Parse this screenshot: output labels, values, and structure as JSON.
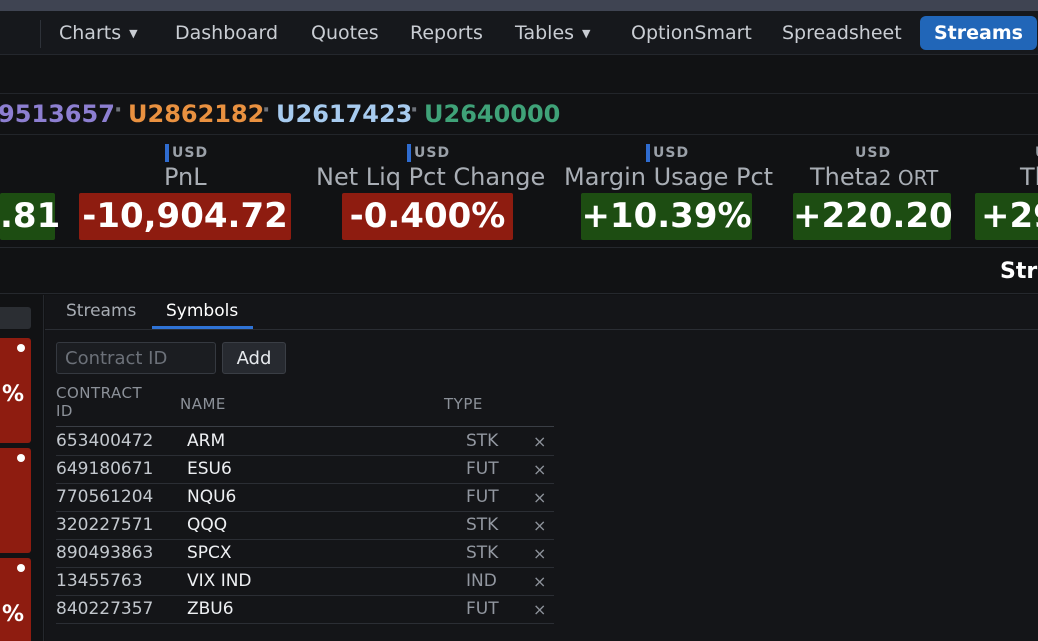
{
  "nav": {
    "items": [
      {
        "label": "Charts",
        "dropdown": true
      },
      {
        "label": "Dashboard",
        "dropdown": false
      },
      {
        "label": "Quotes",
        "dropdown": false
      },
      {
        "label": "Reports",
        "dropdown": false
      },
      {
        "label": "Tables",
        "dropdown": true
      },
      {
        "label": "OptionSmart",
        "dropdown": false
      },
      {
        "label": "Spreadsheet",
        "dropdown": false
      }
    ],
    "active": "Streams",
    "caret": "▼"
  },
  "accounts": {
    "separator": "·",
    "items": [
      {
        "id": "9513657",
        "color": "#8d7fd1"
      },
      {
        "id": "U2862182",
        "color": "#e99140"
      },
      {
        "id": "U2617423",
        "color": "#a7cbef"
      },
      {
        "id": "U2640000",
        "color": "#3fa278"
      }
    ]
  },
  "metrics": [
    {
      "currency": "",
      "label": "",
      "value": ".81",
      "sign": "positive"
    },
    {
      "currency": "USD",
      "label": "PnL",
      "value": "-10,904.72",
      "sign": "negative"
    },
    {
      "currency": "USD",
      "label": "Net Liq Pct Change",
      "value": "-0.400%",
      "sign": "negative"
    },
    {
      "currency": "USD",
      "label": "Margin Usage Pct",
      "value": "+10.39%",
      "sign": "positive"
    },
    {
      "currency": "USD",
      "label": "Theta",
      "label_sub": "2 ORT",
      "value": "+220.20",
      "sign": "positive"
    },
    {
      "currency": "U",
      "label": "Th",
      "value": "+29",
      "sign": "positive"
    }
  ],
  "section_title": "Str",
  "left_cards": [
    {
      "text": "%"
    },
    {
      "text": ""
    },
    {
      "text": "%"
    }
  ],
  "tabs": [
    {
      "label": "Streams",
      "active": false
    },
    {
      "label": "Symbols",
      "active": true
    }
  ],
  "form": {
    "placeholder": "Contract ID",
    "value": "",
    "add_label": "Add"
  },
  "table": {
    "headers": {
      "contract_id_1": "CONTRACT",
      "contract_id_2": "ID",
      "name": "NAME",
      "type": "TYPE"
    },
    "remove_glyph": "×",
    "rows": [
      {
        "contract_id": "653400472",
        "name": "ARM",
        "type": "STK"
      },
      {
        "contract_id": "649180671",
        "name": "ESU6",
        "type": "FUT"
      },
      {
        "contract_id": "770561204",
        "name": "NQU6",
        "type": "FUT"
      },
      {
        "contract_id": "320227571",
        "name": "QQQ",
        "type": "STK"
      },
      {
        "contract_id": "890493863",
        "name": "SPCX",
        "type": "STK"
      },
      {
        "contract_id": "13455763",
        "name": "VIX IND",
        "type": "IND"
      },
      {
        "contract_id": "840227357",
        "name": "ZBU6",
        "type": "FUT"
      }
    ]
  },
  "colors": {
    "accent": "#2166b8",
    "negative": "#8e1c10",
    "positive": "#1d4d12"
  }
}
